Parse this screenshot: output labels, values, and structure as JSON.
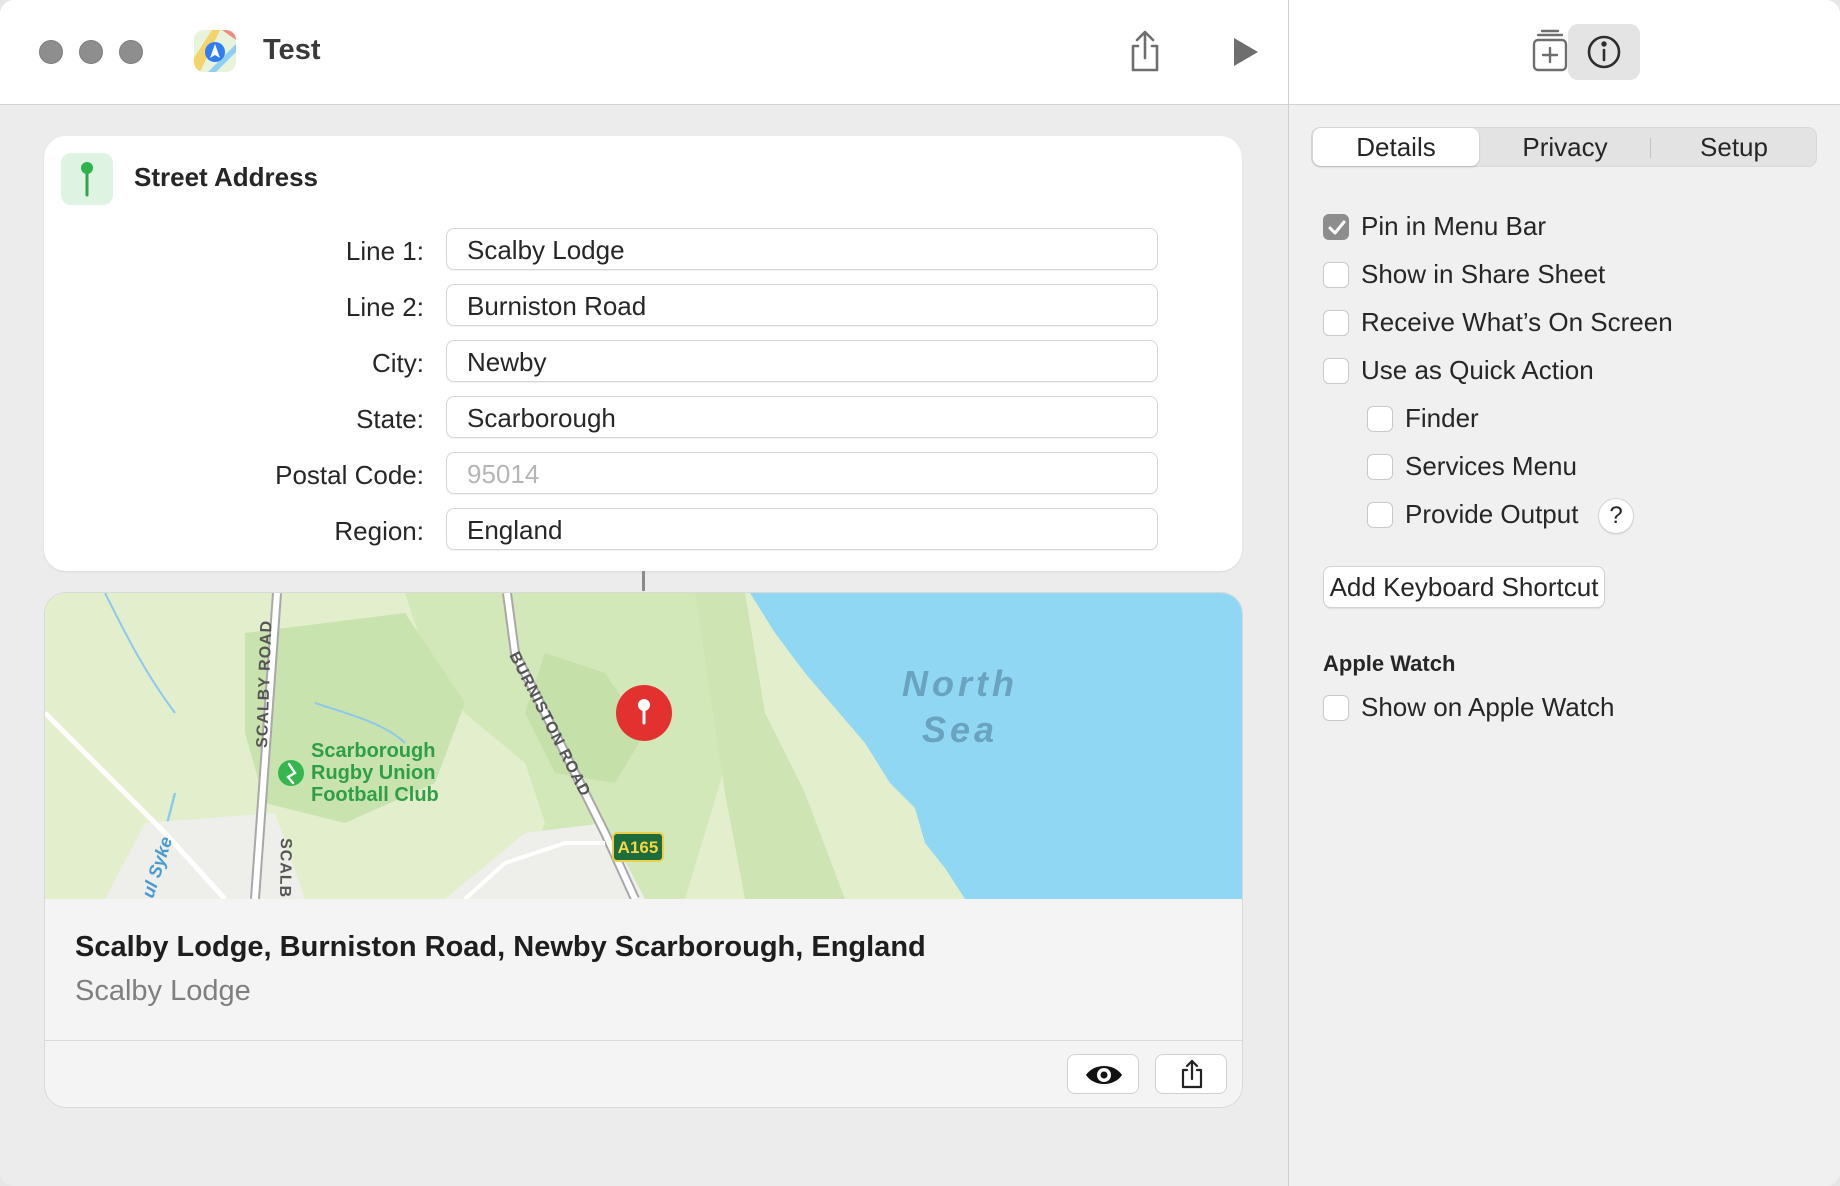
{
  "window": {
    "title": "Test",
    "app_icon": "maps-icon"
  },
  "toolbar": {
    "share_icon": "share-icon",
    "run_icon": "play-icon",
    "library_icon": "add-to-library-icon",
    "info_icon": "info-icon"
  },
  "action": {
    "title": "Street Address",
    "icon": "pin-icon",
    "fields": [
      {
        "label": "Line 1:",
        "value": "Scalby Lodge",
        "placeholder": ""
      },
      {
        "label": "Line 2:",
        "value": "Burniston Road",
        "placeholder": ""
      },
      {
        "label": "City:",
        "value": "Newby",
        "placeholder": ""
      },
      {
        "label": "State:",
        "value": "Scarborough",
        "placeholder": ""
      },
      {
        "label": "Postal Code:",
        "value": "",
        "placeholder": "95014"
      },
      {
        "label": "Region:",
        "value": "England",
        "placeholder": ""
      }
    ]
  },
  "map": {
    "labels": {
      "sea_line1": "North",
      "sea_line2": "Sea",
      "road_scalby": "SCALBY ROAD",
      "road_scalby_lower": "SCALBY",
      "road_burniston": "BURNISTON ROAD",
      "road_a165": "A165",
      "club_line1": "Scarborough",
      "club_line2": "Rugby Union",
      "club_line3": "Football Club",
      "stream": "ul Syke"
    },
    "pin_icon": "map-pin-icon",
    "address_line": "Scalby Lodge, Burniston Road, Newby Scarborough, England",
    "place_name": "Scalby Lodge",
    "colors": {
      "land": "#e3efcc",
      "park": "#c9e3ae",
      "water": "#8fd7f3",
      "pin": "#e3312f"
    }
  },
  "inspector": {
    "tabs": [
      {
        "label": "Details",
        "active": true
      },
      {
        "label": "Privacy",
        "active": false
      },
      {
        "label": "Setup",
        "active": false
      }
    ],
    "options": [
      {
        "label": "Pin in Menu Bar",
        "checked": true
      },
      {
        "label": "Show in Share Sheet",
        "checked": false
      },
      {
        "label": "Receive What’s On Screen",
        "checked": false
      },
      {
        "label": "Use as Quick Action",
        "checked": false
      },
      {
        "label": "Finder",
        "checked": false
      },
      {
        "label": "Services Menu",
        "checked": false
      },
      {
        "label": "Provide Output",
        "checked": false
      }
    ],
    "help_label": "?",
    "keyboard_button": "Add Keyboard Shortcut",
    "watch_section": "Apple Watch",
    "watch_option": {
      "label": "Show on Apple Watch",
      "checked": false
    }
  }
}
